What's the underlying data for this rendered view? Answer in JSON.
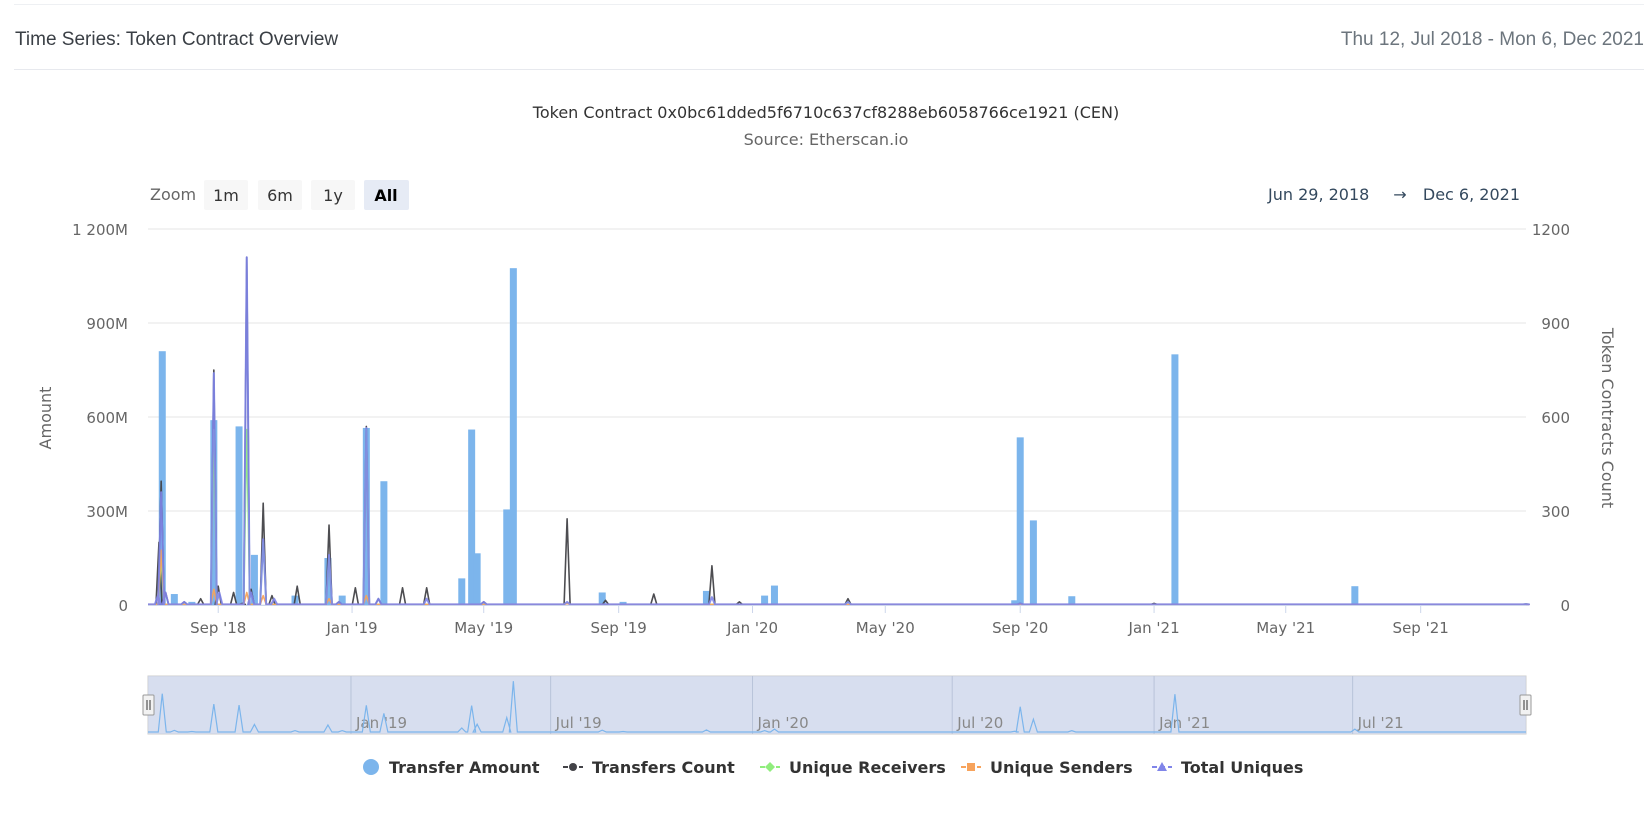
{
  "header": {
    "title": "Time Series: Token Contract Overview",
    "range": "Thu 12, Jul 2018 - Mon 6, Dec 2021"
  },
  "chart": {
    "title": "Token Contract 0x0bc61dded5f6710c637cf8288eb6058766ce1921 (CEN)",
    "subtitle": "Source: Etherscan.io",
    "zoom_label": "Zoom",
    "zoom_buttons": [
      "1m",
      "6m",
      "1y",
      "All"
    ],
    "zoom_selected": "All",
    "range_from": "Jun 29, 2018",
    "range_arrow": "→",
    "range_to": "Dec 6, 2021",
    "navigator_labels": [
      "Jan '19",
      "Jul '19",
      "Jan '20",
      "Jul '20",
      "Jan '21",
      "Jul '21"
    ]
  },
  "colors": {
    "transfer_amount": "#7cb5ec",
    "transfers_count": "#434348",
    "unique_receivers": "#90ed7d",
    "unique_senders": "#f7a35c",
    "total_uniques": "#8085e9",
    "navigator_bg": "#ccd6eb"
  },
  "chart_data": {
    "type": "bar",
    "title": "Token Contract 0x0bc61dded5f6710c637cf8288eb6058766ce1921 (CEN)",
    "subtitle": "Source: Etherscan.io",
    "x_start": "2018-06-29",
    "x_end": "2021-12-06",
    "x_tick_labels": [
      "Sep '18",
      "Jan '19",
      "May '19",
      "Sep '19",
      "Jan '20",
      "May '20",
      "Sep '20",
      "Jan '21",
      "May '21",
      "Sep '21"
    ],
    "x_tick_dates": [
      "2018-09-01",
      "2019-01-01",
      "2019-05-01",
      "2019-09-01",
      "2020-01-01",
      "2020-05-01",
      "2020-09-01",
      "2021-01-01",
      "2021-05-01",
      "2021-09-01"
    ],
    "y_left": {
      "label": "Amount",
      "range": [
        0,
        1200000000
      ],
      "ticks": [
        0,
        300000000,
        600000000,
        900000000,
        1200000000
      ],
      "tick_labels": [
        "0",
        "300M",
        "600M",
        "900M",
        "1 200M"
      ]
    },
    "y_right": {
      "label": "Token Contracts Count",
      "range": [
        0,
        1200
      ],
      "ticks": [
        0,
        300,
        600,
        900,
        1200
      ],
      "tick_labels": [
        "0",
        "300",
        "600",
        "900",
        "1200"
      ]
    },
    "grid": true,
    "legend_position": "bottom",
    "series": [
      {
        "name": "Transfer Amount",
        "type": "column",
        "axis": "left",
        "points": [
          [
            "2018-07-12",
            810000000
          ],
          [
            "2018-07-23",
            35000000
          ],
          [
            "2018-08-08",
            10000000
          ],
          [
            "2018-08-28",
            590000000
          ],
          [
            "2018-09-20",
            570000000
          ],
          [
            "2018-10-04",
            160000000
          ],
          [
            "2018-11-10",
            30000000
          ],
          [
            "2018-12-10",
            150000000
          ],
          [
            "2018-12-23",
            30000000
          ],
          [
            "2019-01-14",
            565000000
          ],
          [
            "2019-01-30",
            395000000
          ],
          [
            "2019-04-11",
            85000000
          ],
          [
            "2019-04-20",
            560000000
          ],
          [
            "2019-04-25",
            165000000
          ],
          [
            "2019-05-22",
            305000000
          ],
          [
            "2019-05-28",
            1075000000
          ],
          [
            "2019-08-17",
            40000000
          ],
          [
            "2019-09-05",
            10000000
          ],
          [
            "2019-11-20",
            45000000
          ],
          [
            "2020-01-12",
            30000000
          ],
          [
            "2020-01-21",
            62000000
          ],
          [
            "2020-08-27",
            15000000
          ],
          [
            "2020-09-01",
            535000000
          ],
          [
            "2020-09-13",
            270000000
          ],
          [
            "2020-10-18",
            28000000
          ],
          [
            "2021-01-20",
            800000000
          ],
          [
            "2021-07-03",
            60000000
          ]
        ]
      },
      {
        "name": "Transfers Count",
        "type": "line",
        "axis": "right",
        "points": [
          [
            "2018-07-09",
            200
          ],
          [
            "2018-07-11",
            395
          ],
          [
            "2018-07-15",
            40
          ],
          [
            "2018-08-01",
            10
          ],
          [
            "2018-08-16",
            20
          ],
          [
            "2018-08-28",
            750
          ],
          [
            "2018-09-01",
            60
          ],
          [
            "2018-09-15",
            40
          ],
          [
            "2018-09-23",
            5
          ],
          [
            "2018-09-27",
            1110
          ],
          [
            "2018-10-01",
            50
          ],
          [
            "2018-10-12",
            325
          ],
          [
            "2018-10-20",
            30
          ],
          [
            "2018-11-12",
            60
          ],
          [
            "2018-12-11",
            255
          ],
          [
            "2018-12-20",
            10
          ],
          [
            "2019-01-04",
            55
          ],
          [
            "2019-01-14",
            570
          ],
          [
            "2019-01-25",
            20
          ],
          [
            "2019-02-16",
            55
          ],
          [
            "2019-03-10",
            55
          ],
          [
            "2019-05-01",
            10
          ],
          [
            "2019-07-16",
            275
          ],
          [
            "2019-08-20",
            15
          ],
          [
            "2019-10-03",
            35
          ],
          [
            "2019-11-25",
            125
          ],
          [
            "2019-12-20",
            10
          ],
          [
            "2020-03-28",
            20
          ],
          [
            "2020-09-01",
            5
          ],
          [
            "2021-01-01",
            5
          ],
          [
            "2021-12-06",
            3
          ]
        ]
      },
      {
        "name": "Unique Receivers",
        "type": "line",
        "axis": "right",
        "points": [
          [
            "2018-07-11",
            150
          ],
          [
            "2018-08-28",
            560
          ],
          [
            "2018-09-27",
            560
          ],
          [
            "2018-10-12",
            200
          ],
          [
            "2018-12-11",
            150
          ],
          [
            "2019-01-14",
            560
          ],
          [
            "2019-07-16",
            8
          ],
          [
            "2020-03-28",
            10
          ],
          [
            "2021-12-06",
            3
          ]
        ]
      },
      {
        "name": "Unique Senders",
        "type": "line",
        "axis": "right",
        "points": [
          [
            "2018-07-11",
            175
          ],
          [
            "2018-08-28",
            50
          ],
          [
            "2018-09-27",
            40
          ],
          [
            "2018-10-12",
            30
          ],
          [
            "2018-12-11",
            20
          ],
          [
            "2019-01-14",
            30
          ],
          [
            "2019-07-16",
            5
          ],
          [
            "2021-12-06",
            2
          ]
        ]
      },
      {
        "name": "Total Uniques",
        "type": "line",
        "axis": "right",
        "points": [
          [
            "2018-07-08",
            30
          ],
          [
            "2018-07-11",
            360
          ],
          [
            "2018-07-15",
            40
          ],
          [
            "2018-08-01",
            10
          ],
          [
            "2018-08-28",
            740
          ],
          [
            "2018-09-02",
            40
          ],
          [
            "2018-09-27",
            1110
          ],
          [
            "2018-10-01",
            40
          ],
          [
            "2018-10-12",
            210
          ],
          [
            "2018-10-22",
            20
          ],
          [
            "2018-12-11",
            160
          ],
          [
            "2018-12-20",
            10
          ],
          [
            "2019-01-14",
            565
          ],
          [
            "2019-01-25",
            20
          ],
          [
            "2019-03-10",
            20
          ],
          [
            "2019-05-01",
            10
          ],
          [
            "2019-07-16",
            10
          ],
          [
            "2019-11-25",
            25
          ],
          [
            "2020-03-28",
            10
          ],
          [
            "2020-09-01",
            5
          ],
          [
            "2021-12-06",
            3
          ]
        ]
      }
    ]
  }
}
